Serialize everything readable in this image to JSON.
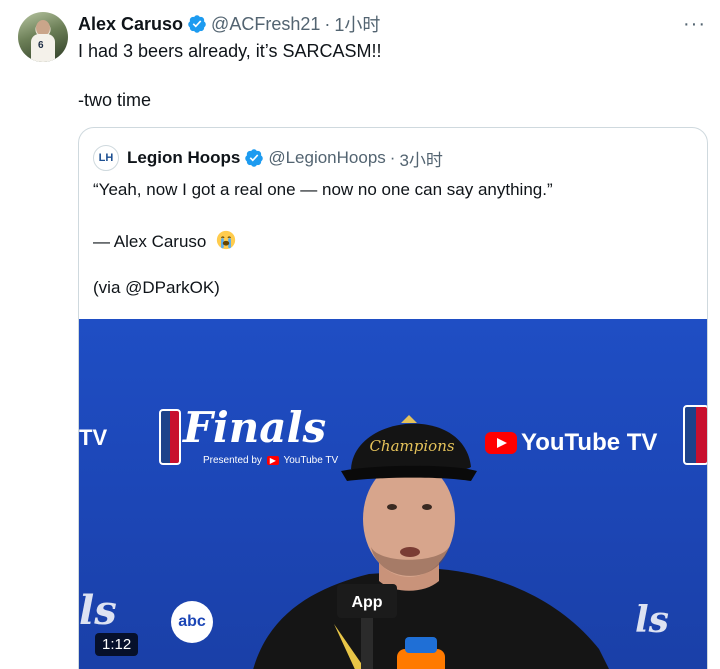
{
  "tweet": {
    "author_name": "Alex Caruso",
    "author_handle": "@ACFresh21",
    "separator": "·",
    "time": "1小时",
    "more_icon": "···",
    "text_line1": "I had 3 beers already, it’s SARCASM!!",
    "text_line2": "-two time"
  },
  "quoted": {
    "author_name": "Legion Hoops",
    "author_handle": "@LegionHoops",
    "separator": "·",
    "time": "3小时",
    "avatar_text": "LH",
    "line1": "“Yeah, now I got a real one — now no one can say anything.”",
    "line2": "— Alex Caruso",
    "line2_emoji": "loudly-crying-face",
    "line3": "(via @DParkOK)"
  },
  "media": {
    "duration": "1:12",
    "signage": {
      "tv_fragment": "TV",
      "finals": "Finals",
      "presented_by": "Presented by",
      "youtube_small": "YouTube TV",
      "youtube_main": "YouTube TV",
      "abc": "abc",
      "ls_left": "ls",
      "ls_right": "ls",
      "cap_text": "Champions",
      "mic_text": "App"
    }
  },
  "colors": {
    "verified": "#1d9bf0",
    "secondary_text": "#536471",
    "border": "#cfd9de",
    "backdrop_blue": "#1f4ec4"
  }
}
